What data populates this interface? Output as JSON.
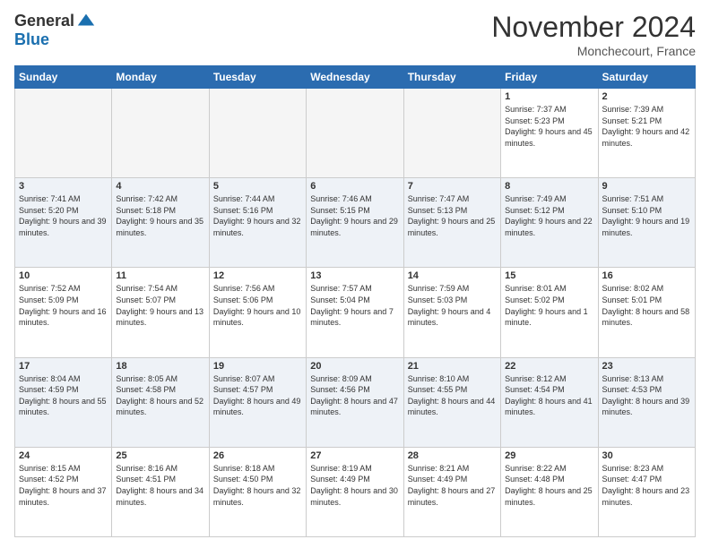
{
  "header": {
    "logo_general": "General",
    "logo_blue": "Blue",
    "month_title": "November 2024",
    "location": "Monchecourt, France"
  },
  "weekdays": [
    "Sunday",
    "Monday",
    "Tuesday",
    "Wednesday",
    "Thursday",
    "Friday",
    "Saturday"
  ],
  "weeks": [
    [
      {
        "day": "",
        "info": ""
      },
      {
        "day": "",
        "info": ""
      },
      {
        "day": "",
        "info": ""
      },
      {
        "day": "",
        "info": ""
      },
      {
        "day": "",
        "info": ""
      },
      {
        "day": "1",
        "info": "Sunrise: 7:37 AM\nSunset: 5:23 PM\nDaylight: 9 hours and 45 minutes."
      },
      {
        "day": "2",
        "info": "Sunrise: 7:39 AM\nSunset: 5:21 PM\nDaylight: 9 hours and 42 minutes."
      }
    ],
    [
      {
        "day": "3",
        "info": "Sunrise: 7:41 AM\nSunset: 5:20 PM\nDaylight: 9 hours and 39 minutes."
      },
      {
        "day": "4",
        "info": "Sunrise: 7:42 AM\nSunset: 5:18 PM\nDaylight: 9 hours and 35 minutes."
      },
      {
        "day": "5",
        "info": "Sunrise: 7:44 AM\nSunset: 5:16 PM\nDaylight: 9 hours and 32 minutes."
      },
      {
        "day": "6",
        "info": "Sunrise: 7:46 AM\nSunset: 5:15 PM\nDaylight: 9 hours and 29 minutes."
      },
      {
        "day": "7",
        "info": "Sunrise: 7:47 AM\nSunset: 5:13 PM\nDaylight: 9 hours and 25 minutes."
      },
      {
        "day": "8",
        "info": "Sunrise: 7:49 AM\nSunset: 5:12 PM\nDaylight: 9 hours and 22 minutes."
      },
      {
        "day": "9",
        "info": "Sunrise: 7:51 AM\nSunset: 5:10 PM\nDaylight: 9 hours and 19 minutes."
      }
    ],
    [
      {
        "day": "10",
        "info": "Sunrise: 7:52 AM\nSunset: 5:09 PM\nDaylight: 9 hours and 16 minutes."
      },
      {
        "day": "11",
        "info": "Sunrise: 7:54 AM\nSunset: 5:07 PM\nDaylight: 9 hours and 13 minutes."
      },
      {
        "day": "12",
        "info": "Sunrise: 7:56 AM\nSunset: 5:06 PM\nDaylight: 9 hours and 10 minutes."
      },
      {
        "day": "13",
        "info": "Sunrise: 7:57 AM\nSunset: 5:04 PM\nDaylight: 9 hours and 7 minutes."
      },
      {
        "day": "14",
        "info": "Sunrise: 7:59 AM\nSunset: 5:03 PM\nDaylight: 9 hours and 4 minutes."
      },
      {
        "day": "15",
        "info": "Sunrise: 8:01 AM\nSunset: 5:02 PM\nDaylight: 9 hours and 1 minute."
      },
      {
        "day": "16",
        "info": "Sunrise: 8:02 AM\nSunset: 5:01 PM\nDaylight: 8 hours and 58 minutes."
      }
    ],
    [
      {
        "day": "17",
        "info": "Sunrise: 8:04 AM\nSunset: 4:59 PM\nDaylight: 8 hours and 55 minutes."
      },
      {
        "day": "18",
        "info": "Sunrise: 8:05 AM\nSunset: 4:58 PM\nDaylight: 8 hours and 52 minutes."
      },
      {
        "day": "19",
        "info": "Sunrise: 8:07 AM\nSunset: 4:57 PM\nDaylight: 8 hours and 49 minutes."
      },
      {
        "day": "20",
        "info": "Sunrise: 8:09 AM\nSunset: 4:56 PM\nDaylight: 8 hours and 47 minutes."
      },
      {
        "day": "21",
        "info": "Sunrise: 8:10 AM\nSunset: 4:55 PM\nDaylight: 8 hours and 44 minutes."
      },
      {
        "day": "22",
        "info": "Sunrise: 8:12 AM\nSunset: 4:54 PM\nDaylight: 8 hours and 41 minutes."
      },
      {
        "day": "23",
        "info": "Sunrise: 8:13 AM\nSunset: 4:53 PM\nDaylight: 8 hours and 39 minutes."
      }
    ],
    [
      {
        "day": "24",
        "info": "Sunrise: 8:15 AM\nSunset: 4:52 PM\nDaylight: 8 hours and 37 minutes."
      },
      {
        "day": "25",
        "info": "Sunrise: 8:16 AM\nSunset: 4:51 PM\nDaylight: 8 hours and 34 minutes."
      },
      {
        "day": "26",
        "info": "Sunrise: 8:18 AM\nSunset: 4:50 PM\nDaylight: 8 hours and 32 minutes."
      },
      {
        "day": "27",
        "info": "Sunrise: 8:19 AM\nSunset: 4:49 PM\nDaylight: 8 hours and 30 minutes."
      },
      {
        "day": "28",
        "info": "Sunrise: 8:21 AM\nSunset: 4:49 PM\nDaylight: 8 hours and 27 minutes."
      },
      {
        "day": "29",
        "info": "Sunrise: 8:22 AM\nSunset: 4:48 PM\nDaylight: 8 hours and 25 minutes."
      },
      {
        "day": "30",
        "info": "Sunrise: 8:23 AM\nSunset: 4:47 PM\nDaylight: 8 hours and 23 minutes."
      }
    ]
  ]
}
